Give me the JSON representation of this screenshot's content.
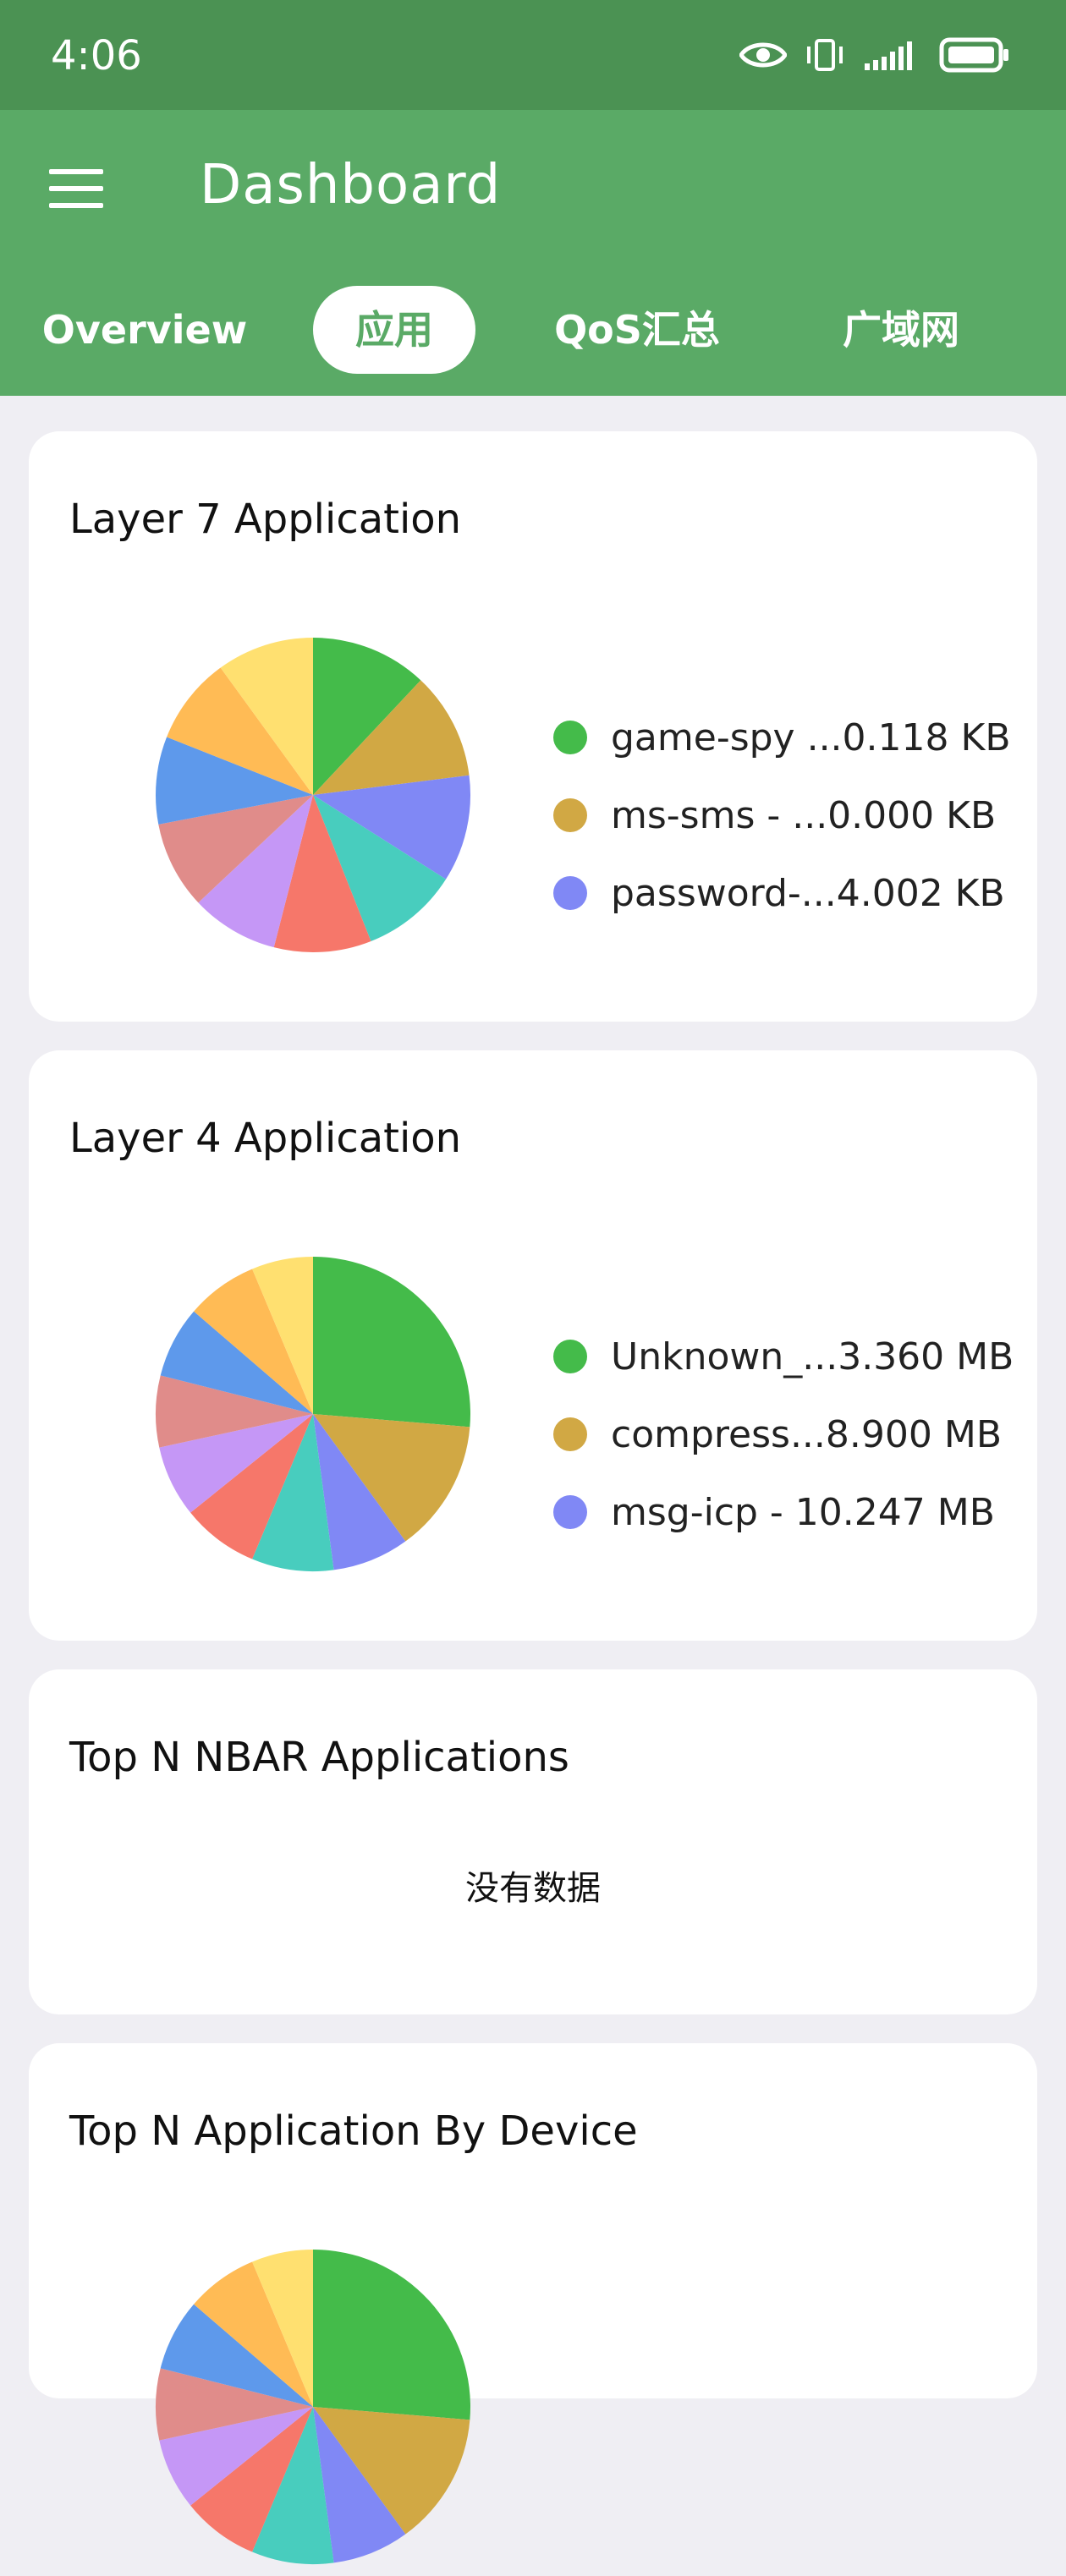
{
  "status_bar": {
    "time": "4:06",
    "icons": [
      "eye-icon",
      "vibrate-icon",
      "signal-icon",
      "battery-icon"
    ]
  },
  "app_bar": {
    "title": "Dashboard",
    "menu_icon": "menu-icon"
  },
  "tabs": [
    {
      "label": "Overview",
      "active": false
    },
    {
      "label": "应用",
      "active": true
    },
    {
      "label": "QoS汇总",
      "active": false
    },
    {
      "label": "广域网",
      "active": false
    }
  ],
  "colors": {
    "status_bar": "#4b9253",
    "app_bar": "#5aaa66",
    "background": "#efeef3",
    "palette": [
      "#44bb4a",
      "#d1a844",
      "#8088f5",
      "#48cdbe",
      "#f6776a",
      "#c597f6",
      "#e08c8a",
      "#5e99eb",
      "#ffbb55",
      "#ffe070"
    ]
  },
  "cards": [
    {
      "title": "Layer 7 Application",
      "chart_data": {
        "type": "pie",
        "values": [
          12,
          11,
          11,
          10,
          10,
          9,
          9,
          9,
          9,
          10
        ],
        "legend": [
          "game-spy ...0.118 KB",
          "ms-sms - ...0.000 KB",
          "password-...4.002 KB"
        ]
      }
    },
    {
      "title": "Layer 4 Application",
      "chart_data": {
        "type": "pie",
        "values": [
          25,
          13,
          7.5,
          8,
          7.5,
          7,
          7,
          7,
          7,
          6
        ],
        "legend": [
          "Unknown_...3.360 MB",
          "compress...8.900 MB",
          "msg-icp - 10.247 MB"
        ]
      }
    },
    {
      "title": "Top N NBAR Applications",
      "no_data": "没有数据"
    },
    {
      "title": "Top N Application By Device",
      "chart_data": {
        "type": "pie",
        "values": [
          25,
          13,
          7.5,
          8,
          7.5,
          7,
          7,
          7,
          7,
          6
        ],
        "legend": []
      }
    }
  ]
}
